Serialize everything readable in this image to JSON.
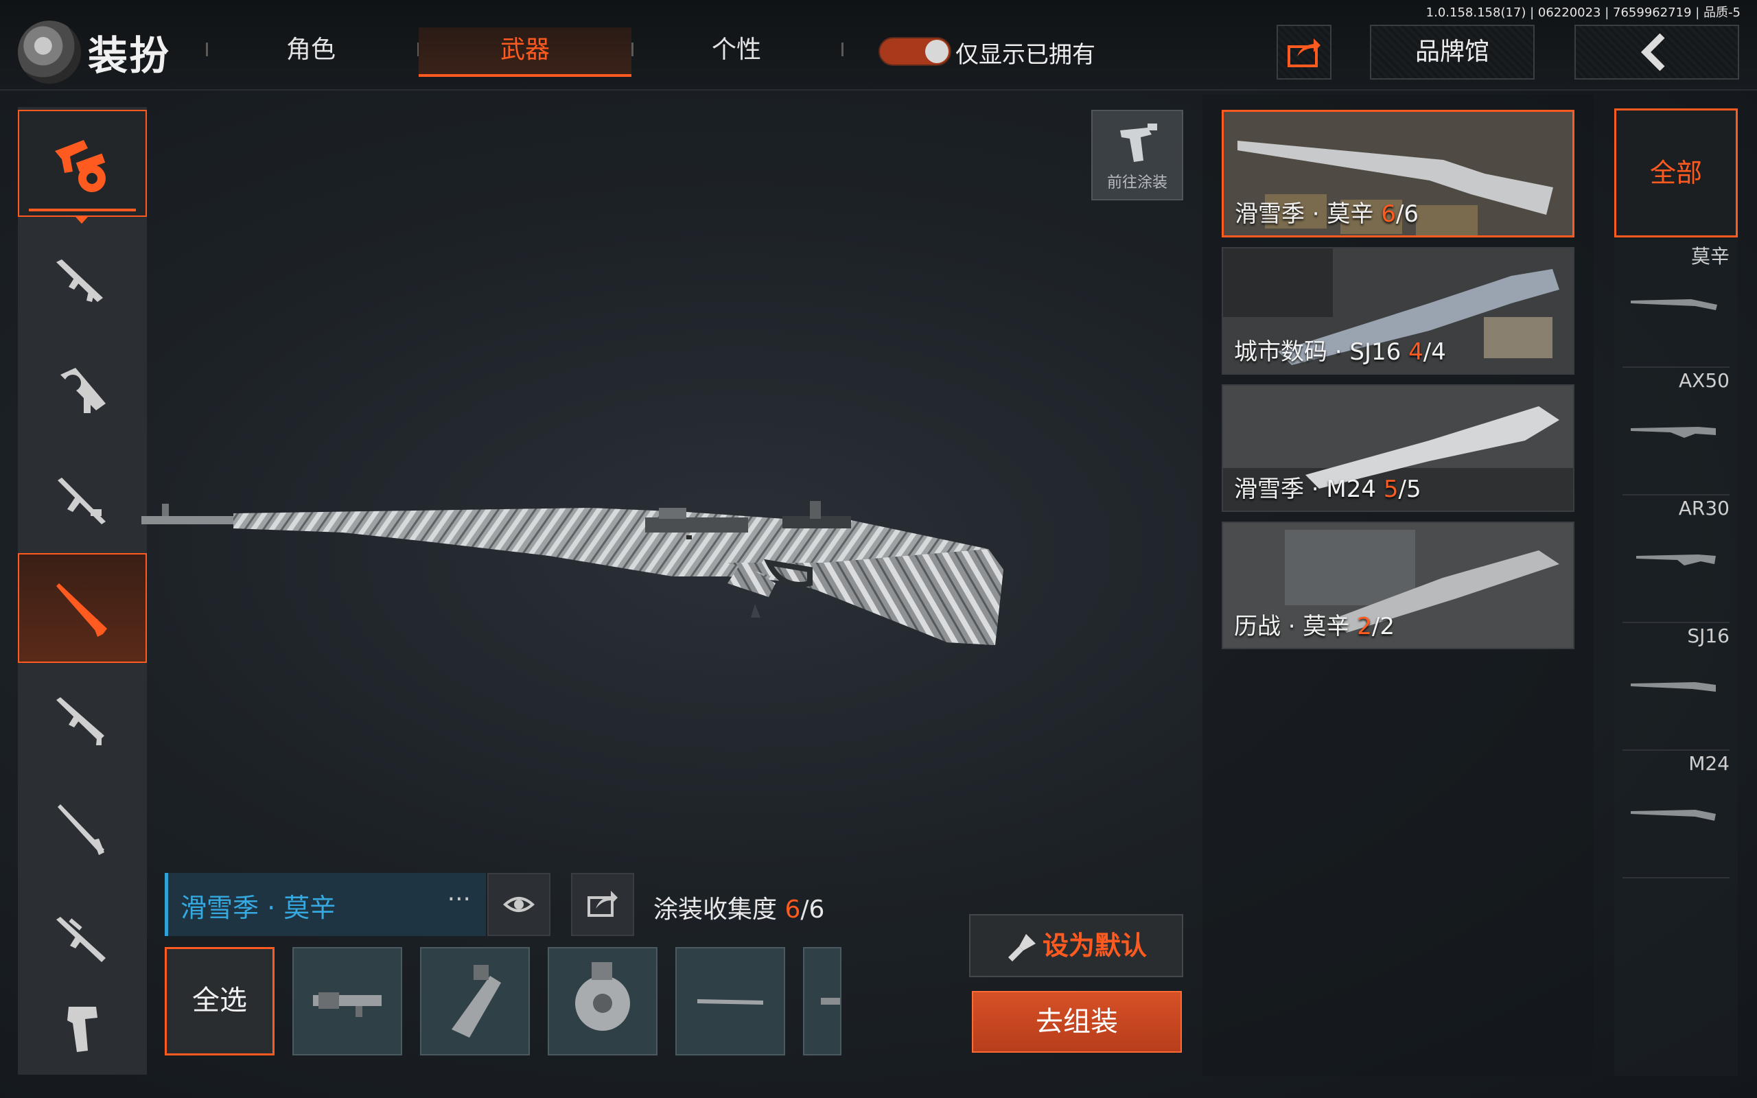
{
  "header": {
    "title": "装扮",
    "version": "1.0.158.158(17) | 06220023 | 7659962719 | 品质-5",
    "tabs": [
      {
        "label": "角色",
        "active": false
      },
      {
        "label": "武器",
        "active": true
      },
      {
        "label": "个性",
        "active": false
      }
    ],
    "owned_toggle": {
      "label": "仅显示已拥有",
      "on": true
    },
    "share_icon": "share-icon",
    "brand_button": "品牌馆",
    "back_icon": "back-arrow-icon"
  },
  "sidebar": {
    "categories": [
      {
        "icon": "all-weapons-icon",
        "active_first": true
      },
      {
        "icon": "assault-rifle-icon"
      },
      {
        "icon": "smg-icon"
      },
      {
        "icon": "lmg-icon"
      },
      {
        "icon": "sniper-rifle-icon",
        "active": true
      },
      {
        "icon": "carbine-icon"
      },
      {
        "icon": "shotgun-icon"
      },
      {
        "icon": "dmr-icon"
      },
      {
        "icon": "pistol-icon"
      }
    ]
  },
  "goto_paint": {
    "label": "前往涂装",
    "icon": "spray-gun-icon"
  },
  "skins": [
    {
      "name": "滑雪季 · 莫辛",
      "owned": "6",
      "total": "/6",
      "selected": true
    },
    {
      "name": "城市数码 · SJ16",
      "owned": "4",
      "total": "/4"
    },
    {
      "name": "滑雪季 · M24",
      "owned": "5",
      "total": "/5"
    },
    {
      "name": "历战 · 莫辛",
      "owned": "2",
      "total": "/2"
    }
  ],
  "weapon_filter": {
    "all_label": "全部",
    "items": [
      "莫辛",
      "AX50",
      "AR30",
      "SJ16",
      "M24"
    ]
  },
  "current_skin": {
    "name": "滑雪季 · 莫辛",
    "more": "···",
    "collection_label": "涂装收集度",
    "collection_owned": "6",
    "collection_total": "/6"
  },
  "parts": {
    "select_all": "全选",
    "slots": [
      "muzzle-part-icon",
      "magazine-part-icon",
      "drum-part-icon",
      "barrel-part-icon",
      "partial-part-icon"
    ]
  },
  "actions": {
    "set_default": "设为默认",
    "go_assemble": "去组装"
  },
  "colors": {
    "accent": "#ff5a1f",
    "name_blue": "#35a9e0"
  }
}
